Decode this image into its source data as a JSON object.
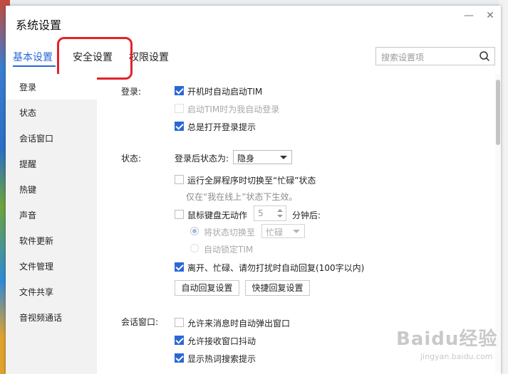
{
  "window": {
    "title": "系统设置",
    "minimize_icon": "minimize-icon",
    "close_icon": "close-icon"
  },
  "tabs": [
    {
      "label": "基本设置",
      "active": true
    },
    {
      "label": "安全设置",
      "active": false
    },
    {
      "label": "权限设置",
      "active": false
    }
  ],
  "search": {
    "placeholder": "搜索设置项"
  },
  "sidebar": {
    "items": [
      {
        "label": "登录",
        "active": true
      },
      {
        "label": "状态"
      },
      {
        "label": "会话窗口"
      },
      {
        "label": "提醒"
      },
      {
        "label": "热键"
      },
      {
        "label": "声音"
      },
      {
        "label": "软件更新"
      },
      {
        "label": "文件管理"
      },
      {
        "label": "文件共享"
      },
      {
        "label": "音视频通话"
      }
    ]
  },
  "login": {
    "label": "登录:",
    "auto_start": {
      "label": "开机时自动启动TIM",
      "checked": true
    },
    "auto_login": {
      "label": "启动TIM时为我自动登录",
      "checked": false,
      "disabled": true
    },
    "show_tip": {
      "label": "总是打开登录提示",
      "checked": true
    }
  },
  "status": {
    "label": "状态:",
    "after_login_label": "登录后状态为:",
    "after_login_value": "隐身",
    "fullscreen_busy": {
      "label": "运行全屏程序时切换至“忙碌”状态",
      "checked": false
    },
    "fullscreen_hint": "仅在“我在线上”状态下生效。",
    "idle": {
      "label": "鼠标键盘无动作",
      "checked": false,
      "minutes": "5",
      "suffix": "分钟后:"
    },
    "switch_to": {
      "label": "将状态切换至",
      "value": "忙碌",
      "selected": true
    },
    "auto_lock": {
      "label": "自动锁定TIM",
      "selected": false
    },
    "auto_reply": {
      "label": "离开、忙碌、请勿打扰时自动回复(100字以内)",
      "checked": true
    },
    "auto_reply_button": "自动回复设置",
    "quick_reply_button": "快捷回复设置"
  },
  "session": {
    "label": "会话窗口:",
    "popup": {
      "label": "允许来消息时自动弹出窗口",
      "checked": false
    },
    "shake": {
      "label": "允许接收窗口抖动",
      "checked": true
    },
    "hot_search": {
      "label": "显示热词搜索提示",
      "checked": true
    }
  },
  "watermark": {
    "brand": "Baidu经验",
    "url": "jingyan.baidu.com"
  },
  "colors": {
    "accent": "#2a67d6",
    "highlight": "#e0242a"
  }
}
